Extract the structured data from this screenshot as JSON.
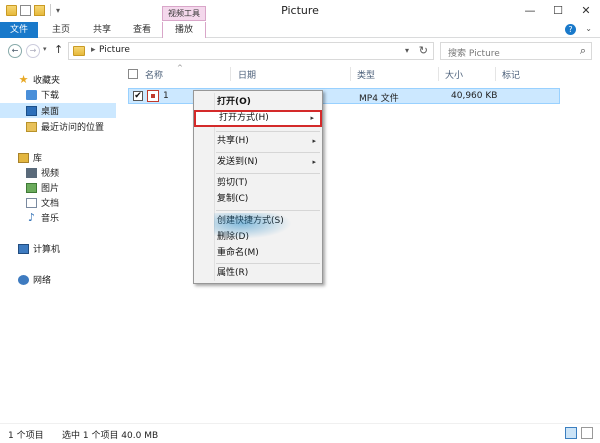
{
  "window": {
    "title": "Picture",
    "contextual_tab": "视频工具",
    "minimize": "—",
    "maximize": "☐",
    "close": "✕"
  },
  "ribbon": {
    "tabs": [
      "文件",
      "主页",
      "共享",
      "查看",
      "播放"
    ],
    "help": "?",
    "expand": "⌄"
  },
  "address": {
    "path": "Picture",
    "separator": "▸",
    "search_placeholder": "搜索 Picture"
  },
  "nav": {
    "favorites": "收藏夹",
    "downloads": "下载",
    "desktop": "桌面",
    "recent": "最近访问的位置",
    "libraries": "库",
    "videos": "视频",
    "pictures": "图片",
    "documents": "文档",
    "music": "音乐",
    "computer": "计算机",
    "network": "网络"
  },
  "columns": {
    "name": "名称",
    "date": "日期",
    "type": "类型",
    "size": "大小",
    "tags": "标记"
  },
  "file": {
    "name": "1",
    "type": "MP4 文件",
    "size": "40,960 KB",
    "checked": "✔"
  },
  "context_menu": {
    "open": "打开(O)",
    "open_with": "打开方式(H)",
    "share": "共享(H)",
    "send_to": "发送到(N)",
    "cut": "剪切(T)",
    "copy": "复制(C)",
    "create_shortcut": "创建快捷方式(S)",
    "delete": "删除(D)",
    "rename": "重命名(M)",
    "properties": "属性(R)",
    "submenu_arrow": "▸"
  },
  "status": {
    "item_count": "1 个项目",
    "selection": "选中 1 个项目  40.0 MB"
  },
  "colors": {
    "file_tab": "#1979ca",
    "selection": "#cce8ff",
    "highlight_border": "#d42a2a",
    "contextual": "#f4d8ec"
  }
}
